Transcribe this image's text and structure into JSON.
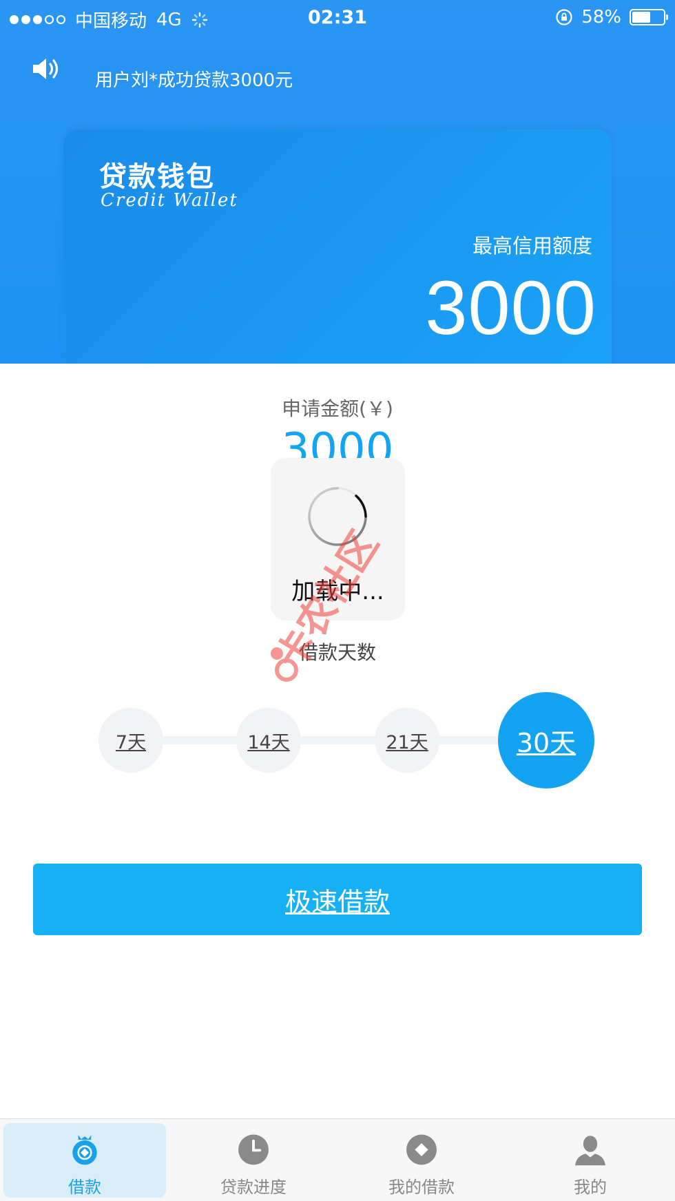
{
  "status_bar": {
    "carrier": "中国移动",
    "network": "4G",
    "time": "02:31",
    "battery": "58%",
    "battery_level": 0.58
  },
  "notice": {
    "text": "用户刘*成功贷款3000元"
  },
  "card": {
    "title_cn": "贷款钱包",
    "title_en": "Credit Wallet",
    "limit_label": "最高信用额度",
    "limit_value": "3000"
  },
  "apply": {
    "label": "申请金额(￥)",
    "amount": "3000"
  },
  "loading": {
    "text": "加载中..."
  },
  "days": {
    "label": "借款天数",
    "options": [
      "7天",
      "14天",
      "21天",
      "30天"
    ],
    "selected": "30天"
  },
  "cta": {
    "label": "极速借款"
  },
  "tabs": [
    {
      "label": "借款",
      "icon": "wallet-bag-icon",
      "active": true
    },
    {
      "label": "贷款进度",
      "icon": "clock-icon",
      "active": false
    },
    {
      "label": "我的借款",
      "icon": "diamond-icon",
      "active": false
    },
    {
      "label": "我的",
      "icon": "person-icon",
      "active": false
    }
  ],
  "colors": {
    "brand": "#1e92f2",
    "accent": "#14a3f0",
    "cta": "#16b1f5",
    "tab_active": "#19a2ec",
    "watermark": "#f0423c"
  },
  "watermark": {
    "text": "卡农社区"
  }
}
